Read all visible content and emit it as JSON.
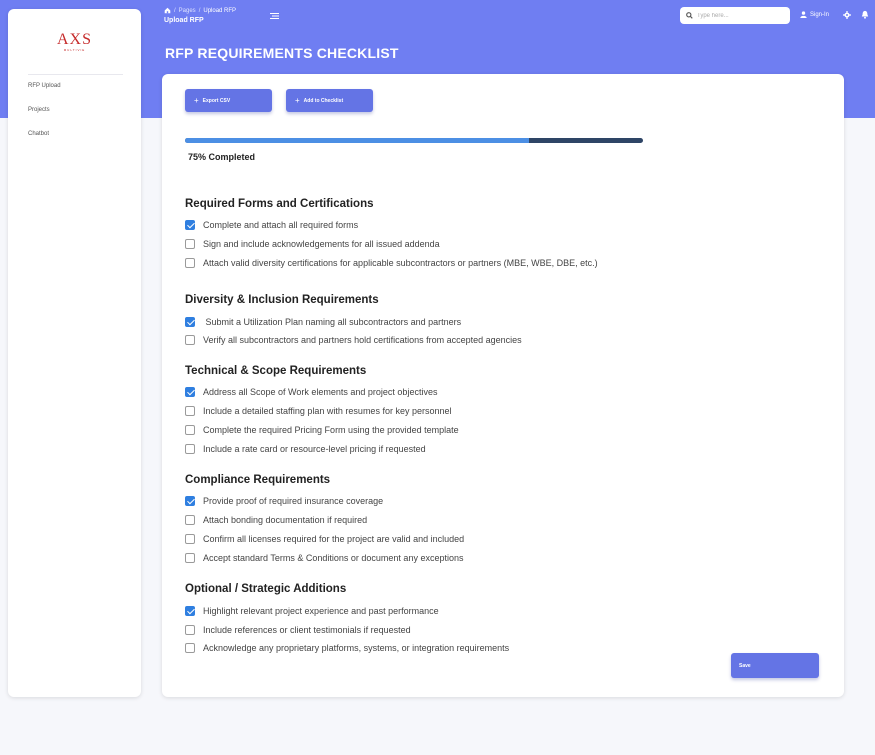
{
  "brand": {
    "logo_text": "AXS",
    "logo_sub": "MULTIVIE"
  },
  "sidebar": {
    "items": [
      {
        "label": "RFP Upload"
      },
      {
        "label": "Projects"
      },
      {
        "label": "Chatbot"
      }
    ]
  },
  "breadcrumb": {
    "parent": "Pages",
    "separator": "/",
    "current": "Upload RFP"
  },
  "header": {
    "subtitle": "Upload RFP",
    "search_placeholder": "Type here...",
    "signin_label": "Sign-In"
  },
  "page": {
    "title": "RFP REQUIREMENTS CHECKLIST"
  },
  "toolbar": {
    "export_label": "Export CSV",
    "add_label": "Add to Checklist"
  },
  "progress": {
    "percent": 75,
    "label": "75% Completed"
  },
  "sections": [
    {
      "title": "Required Forms and Certifications",
      "items": [
        {
          "label": "Complete and attach all required forms",
          "checked": true
        },
        {
          "label": "Sign and include acknowledgements for all issued addenda",
          "checked": false
        },
        {
          "label": "Attach valid diversity certifications for applicable subcontractors or partners (MBE, WBE, DBE, etc.)",
          "checked": false
        }
      ]
    },
    {
      "title": "Diversity & Inclusion Requirements",
      "items": [
        {
          "label": " Submit a Utilization Plan naming all subcontractors and partners",
          "checked": true
        },
        {
          "label": "Verify all subcontractors and partners hold certifications from accepted agencies",
          "checked": false
        }
      ]
    },
    {
      "title": "Technical & Scope Requirements",
      "items": [
        {
          "label": "Address all Scope of Work elements and project objectives",
          "checked": true
        },
        {
          "label": "Include a detailed staffing plan with resumes for key personnel",
          "checked": false
        },
        {
          "label": "Complete the required Pricing Form using the provided template",
          "checked": false
        },
        {
          "label": "Include a rate card or resource-level pricing if requested",
          "checked": false
        }
      ]
    },
    {
      "title": "Compliance Requirements",
      "items": [
        {
          "label": "Provide proof of required insurance coverage",
          "checked": true
        },
        {
          "label": "Attach bonding documentation if required",
          "checked": false
        },
        {
          "label": "Confirm all licenses required for the project are valid and included",
          "checked": false
        },
        {
          "label": "Accept standard Terms & Conditions or document any exceptions",
          "checked": false
        }
      ]
    },
    {
      "title": "Optional / Strategic Additions",
      "items": [
        {
          "label": "Highlight relevant project experience and past performance",
          "checked": true
        },
        {
          "label": "Include references or client testimonials if requested",
          "checked": false
        },
        {
          "label": "Acknowledge any proprietary platforms, systems, or integration requirements",
          "checked": false
        }
      ]
    }
  ],
  "footer": {
    "save_label": "Save"
  },
  "colors": {
    "header_band": "#6f7ef2",
    "button": "#6474e5",
    "progress_fill": "#4c8fe4",
    "progress_track": "#2e4566",
    "checkbox_on": "#2f7fe0"
  }
}
